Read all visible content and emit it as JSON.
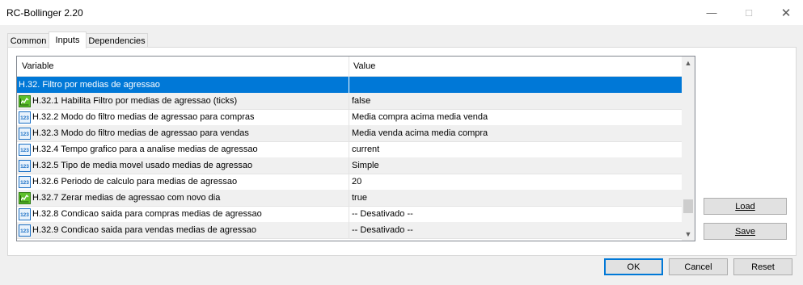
{
  "window": {
    "title": "RC-Bollinger 2.20"
  },
  "tabs": [
    {
      "label": "Common"
    },
    {
      "label": "Inputs"
    },
    {
      "label": "Dependencies"
    }
  ],
  "grid": {
    "columns": {
      "variable": "Variable",
      "value": "Value"
    },
    "rows": [
      {
        "label": "H.32. Filtro por medias de agressao",
        "value": "",
        "icon": "none"
      },
      {
        "label": "H.32.1 Habilita Filtro por medias de agressao (ticks)",
        "value": "false",
        "icon": "boolean-icon"
      },
      {
        "label": "H.32.2 Modo do filtro medias de agressao para compras",
        "value": "Media compra acima media venda",
        "icon": "number-icon"
      },
      {
        "label": "H.32.3 Modo do filtro medias de agressao para vendas",
        "value": "Media venda acima media compra",
        "icon": "number-icon"
      },
      {
        "label": "H.32.4 Tempo grafico para a analise medias de agressao",
        "value": "current",
        "icon": "number-icon"
      },
      {
        "label": "H.32.5 Tipo de media movel usado medias de agressao",
        "value": "Simple",
        "icon": "number-icon"
      },
      {
        "label": "H.32.6 Periodo de calculo para medias de agressao",
        "value": "20",
        "icon": "number-icon"
      },
      {
        "label": "H.32.7 Zerar medias de agressao com novo dia",
        "value": "true",
        "icon": "boolean-icon"
      },
      {
        "label": "H.32.8 Condicao saida para compras medias de agressao",
        "value": "-- Desativado --",
        "icon": "number-icon"
      },
      {
        "label": "H.32.9 Condicao saida para vendas medias de agressao",
        "value": "-- Desativado --",
        "icon": "number-icon"
      }
    ]
  },
  "side_buttons": {
    "load": "Load",
    "save": "Save"
  },
  "footer_buttons": {
    "ok": "OK",
    "cancel": "Cancel",
    "reset": "Reset"
  },
  "colors": {
    "selection": "#0078d7",
    "boolean_icon": "#3a9a1e",
    "number_icon": "#1a6fc4"
  }
}
